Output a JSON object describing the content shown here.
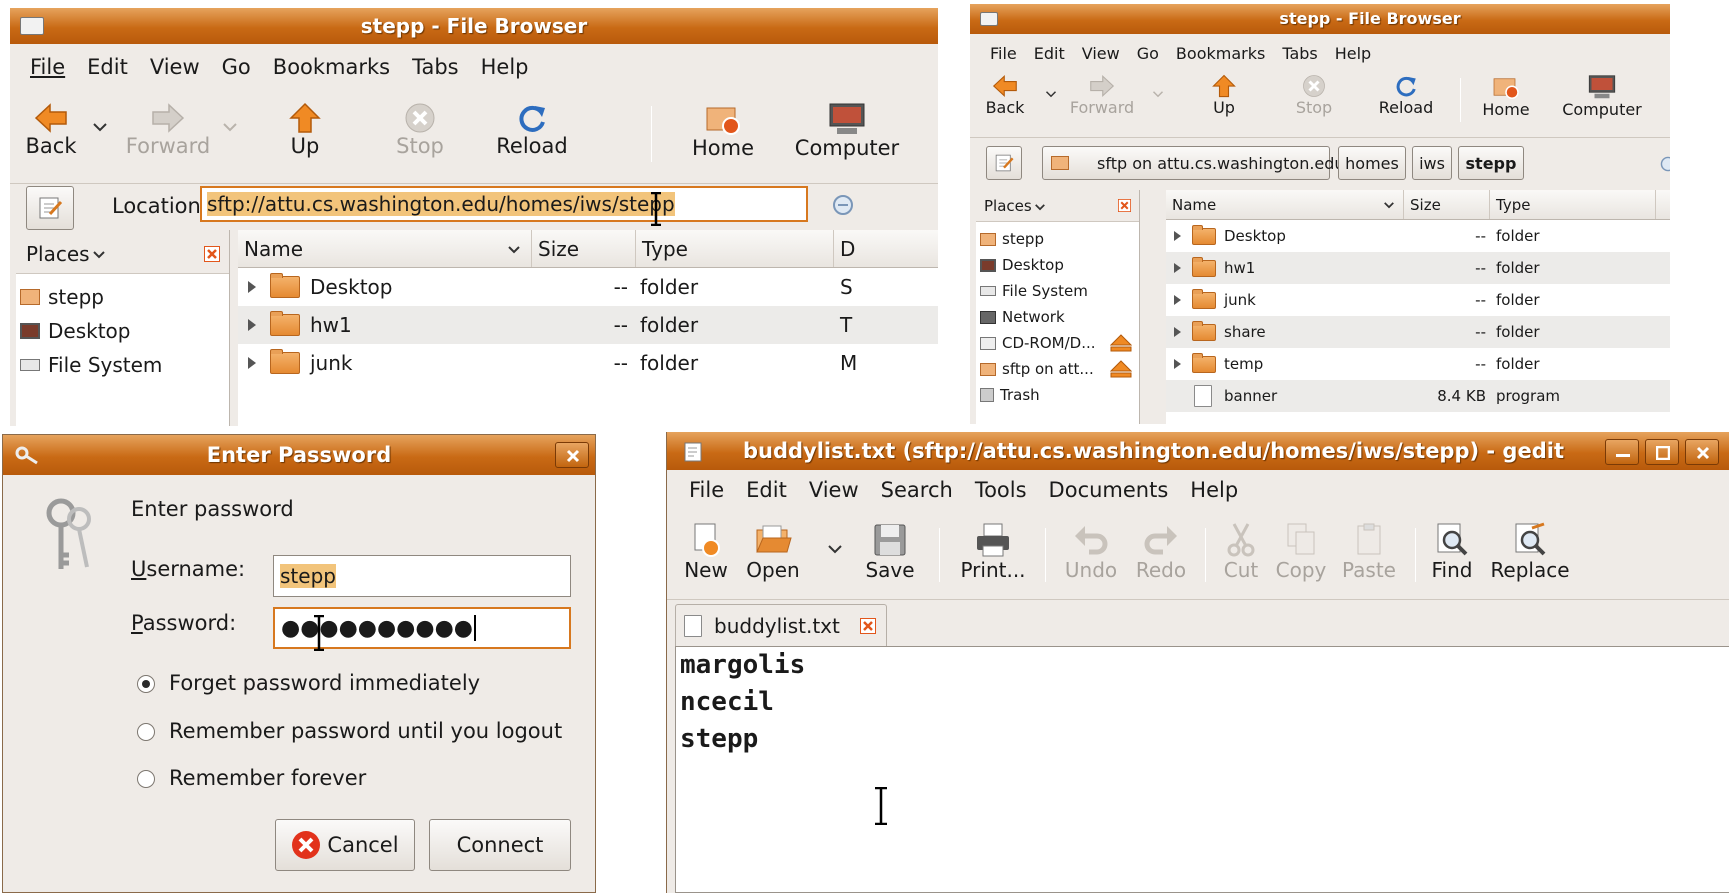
{
  "fb1": {
    "title": "stepp - File Browser",
    "menu": [
      "File",
      "Edit",
      "View",
      "Go",
      "Bookmarks",
      "Tabs",
      "Help"
    ],
    "toolbar": {
      "back": "Back",
      "forward": "Forward",
      "up": "Up",
      "stop": "Stop",
      "reload": "Reload",
      "home": "Home",
      "computer": "Computer"
    },
    "location_label": "Location:",
    "location_value": "sftp://attu.cs.washington.edu/homes/iws/stepp",
    "places_label": "Places",
    "places": [
      "stepp",
      "Desktop",
      "File System"
    ],
    "columns": {
      "name": "Name",
      "size": "Size",
      "type": "Type",
      "date": "D"
    },
    "rows": [
      {
        "name": "Desktop",
        "size": "--",
        "type": "folder",
        "extra": "S"
      },
      {
        "name": "hw1",
        "size": "--",
        "type": "folder",
        "extra": "T"
      },
      {
        "name": "junk",
        "size": "--",
        "type": "folder",
        "extra": "M"
      }
    ]
  },
  "fb2": {
    "title": "stepp - File Browser",
    "menu": [
      "File",
      "Edit",
      "View",
      "Go",
      "Bookmarks",
      "Tabs",
      "Help"
    ],
    "toolbar": {
      "back": "Back",
      "forward": "Forward",
      "up": "Up",
      "stop": "Stop",
      "reload": "Reload",
      "home": "Home",
      "computer": "Computer"
    },
    "path": [
      "sftp on attu.cs.washington.edu",
      "homes",
      "iws",
      "stepp"
    ],
    "places_label": "Places",
    "places": [
      "stepp",
      "Desktop",
      "File System",
      "Network",
      "CD-ROM/D...",
      "sftp on att...",
      "Trash"
    ],
    "columns": {
      "name": "Name",
      "size": "Size",
      "type": "Type"
    },
    "rows": [
      {
        "name": "Desktop",
        "size": "--",
        "type": "folder"
      },
      {
        "name": "hw1",
        "size": "--",
        "type": "folder"
      },
      {
        "name": "junk",
        "size": "--",
        "type": "folder"
      },
      {
        "name": "share",
        "size": "--",
        "type": "folder"
      },
      {
        "name": "temp",
        "size": "--",
        "type": "folder"
      },
      {
        "name": "banner",
        "size": "8.4 KB",
        "type": "program"
      }
    ]
  },
  "pwd": {
    "title": "Enter Password",
    "heading": "Enter password",
    "username_label": "Username:",
    "username_value": "stepp",
    "password_label": "Password:",
    "password_value": "●●●●●●●●●●",
    "options": [
      "Forget password immediately",
      "Remember password until you logout",
      "Remember forever"
    ],
    "selected_option": 0,
    "cancel": "Cancel",
    "connect": "Connect"
  },
  "gedit": {
    "title": "buddylist.txt (sftp://attu.cs.washington.edu/homes/iws/stepp) - gedit",
    "menu": [
      "File",
      "Edit",
      "View",
      "Search",
      "Tools",
      "Documents",
      "Help"
    ],
    "toolbar": {
      "new": "New",
      "open": "Open",
      "save": "Save",
      "print": "Print...",
      "undo": "Undo",
      "redo": "Redo",
      "cut": "Cut",
      "copy": "Copy",
      "paste": "Paste",
      "find": "Find",
      "replace": "Replace"
    },
    "tab": "buddylist.txt",
    "lines": [
      "margolis",
      "ncecil",
      "stepp"
    ]
  }
}
